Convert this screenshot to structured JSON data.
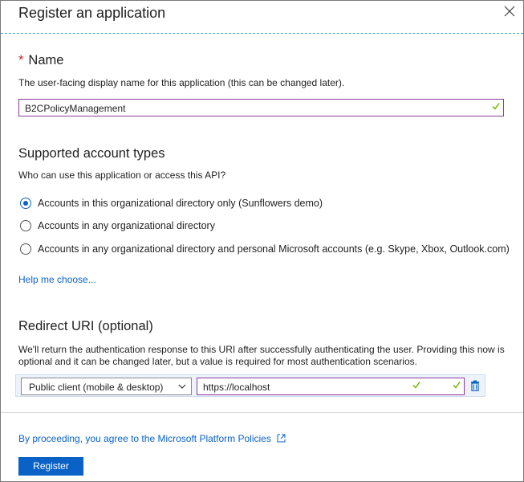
{
  "dialog": {
    "title": "Register an application",
    "close_icon": "close-icon"
  },
  "name_section": {
    "required_marker": "*",
    "title": "Name",
    "description": "The user-facing display name for this application (this can be changed later).",
    "value": "B2CPolicyManagement"
  },
  "account_types": {
    "title": "Supported account types",
    "question": "Who can use this application or access this API?",
    "options": [
      {
        "label": "Accounts in this organizational directory only (Sunflowers demo)",
        "selected": true
      },
      {
        "label": "Accounts in any organizational directory",
        "selected": false
      },
      {
        "label": "Accounts in any organizational directory and personal Microsoft accounts (e.g. Skype, Xbox, Outlook.com)",
        "selected": false
      }
    ],
    "help_link": "Help me choose..."
  },
  "redirect": {
    "title": "Redirect URI (optional)",
    "description_line1": "We'll return the authentication response to this URI after successfully authenticating the user. Providing this now is",
    "description_line2": "optional and it can be changed later, but a value is required for most authentication scenarios.",
    "platform_value": "Public client (mobile & desktop)",
    "uri_value": "https://localhost"
  },
  "footer": {
    "policy_text": "By proceeding, you agree to the Microsoft Platform Policies",
    "register_label": "Register"
  },
  "colors": {
    "accent": "#0a62c7",
    "valid_check": "#6bb700",
    "input_border": "#8a3a9e",
    "required": "#c4262e"
  }
}
